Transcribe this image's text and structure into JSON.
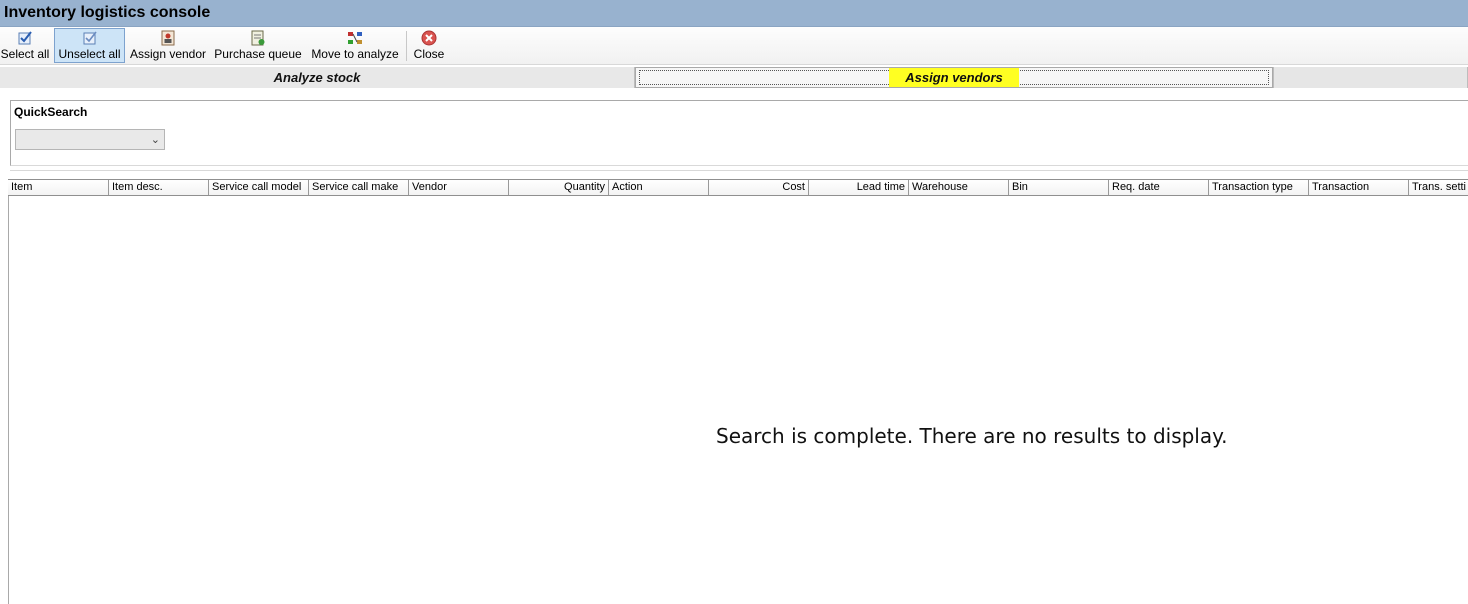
{
  "window": {
    "title": "Inventory logistics console"
  },
  "toolbar": {
    "buttons": [
      {
        "label": "Select all",
        "icon": "check-icon"
      },
      {
        "label": "Unselect all",
        "icon": "uncheck-icon"
      },
      {
        "label": "Assign vendor",
        "icon": "person-icon"
      },
      {
        "label": "Purchase queue",
        "icon": "queue-icon"
      },
      {
        "label": "Move to analyze",
        "icon": "move-icon"
      },
      {
        "label": "Close",
        "icon": "close-icon"
      }
    ]
  },
  "tabs": {
    "analyze": "Analyze stock",
    "assign": "Assign vendors",
    "active": "assign",
    "highlight_color": "#ffff22"
  },
  "quicksearch": {
    "label": "QuickSearch",
    "value": ""
  },
  "grid": {
    "columns": [
      "Item",
      "Item desc.",
      "Service call model",
      "Service call make",
      "Vendor",
      "Quantity",
      "Action",
      "Cost",
      "Lead time",
      "Warehouse",
      "Bin",
      "Req. date",
      "Transaction type",
      "Transaction",
      "Trans. setti"
    ],
    "empty_message": "Search is complete. There are no results to display."
  },
  "colors": {
    "titlebar": "#98b2cf",
    "active_button": "#cde4f7"
  }
}
